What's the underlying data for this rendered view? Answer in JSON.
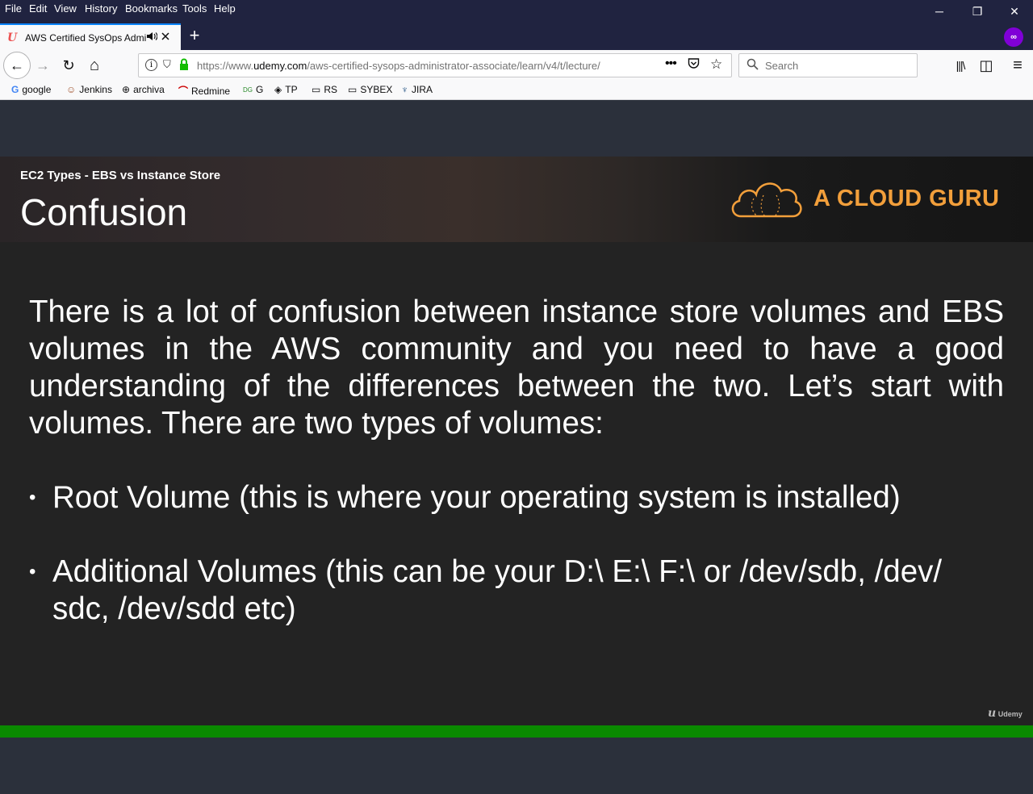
{
  "menu": [
    "File",
    "Edit",
    "View",
    "History",
    "Bookmarks",
    "Tools",
    "Help"
  ],
  "window_controls": {
    "minimize": "─",
    "restore": "❐",
    "close": "✕"
  },
  "tab": {
    "title": "AWS Certified SysOps Admi",
    "favicon": "U"
  },
  "newtab_label": "+",
  "mask_badge": "∞",
  "nav": {
    "back": "←",
    "forward": "→",
    "reload": "↻",
    "home": "⌂"
  },
  "urlbar": {
    "prefix": "https://www.",
    "host": "udemy.com",
    "path": "/aws-certified-sysops-administrator-associate/learn/v4/t/lecture/",
    "more": "•••"
  },
  "search": {
    "placeholder": "Search"
  },
  "toolbar_right": {
    "library": "|||\\",
    "sidebar": "◫",
    "menu": "≡"
  },
  "bookmarks": [
    {
      "label": "google",
      "icon": "G"
    },
    {
      "label": "Jenkins",
      "icon": "☺"
    },
    {
      "label": "archiva",
      "icon": "⊕"
    },
    {
      "label": "Redmine",
      "icon": "⌒"
    },
    {
      "label": "G",
      "icon": "DG"
    },
    {
      "label": "TP",
      "icon": "◈"
    },
    {
      "label": "RS",
      "icon": "▭"
    },
    {
      "label": "SYBEX",
      "icon": "▭"
    },
    {
      "label": "JIRA",
      "icon": "♆"
    }
  ],
  "slide": {
    "subtitle": "EC2 Types - EBS vs Instance Store",
    "heading": "Confusion",
    "logo_text": "A CLOUD GURU",
    "paragraph": "There is a lot of confusion between instance store volumes and EBS volumes in the AWS community and you need to have a good understanding of the differences between the two. Let’s start with volumes. There are two types of volumes:",
    "bullets": [
      "Root Volume (this is where your operating system is installed)",
      "Additional Volumes (this can be your D:\\ E:\\ F:\\ or /dev/sdb, /dev/ sdc, /dev/sdd etc)"
    ],
    "watermark": "Udemy"
  },
  "colors": {
    "accent": "#0a84ff",
    "logo": "#f29f3b",
    "progress": "#0a8a00",
    "chrome_dark": "#202340"
  }
}
